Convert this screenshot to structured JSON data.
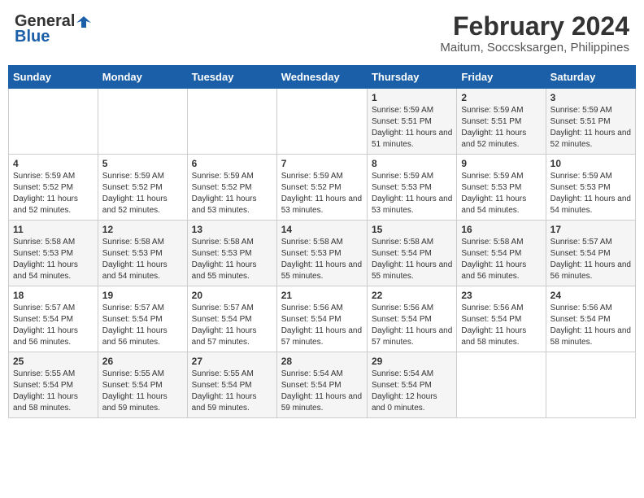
{
  "logo": {
    "line1": "General",
    "line2": "Blue"
  },
  "title": {
    "month": "February 2024",
    "location": "Maitum, Soccsksargen, Philippines"
  },
  "weekdays": [
    "Sunday",
    "Monday",
    "Tuesday",
    "Wednesday",
    "Thursday",
    "Friday",
    "Saturday"
  ],
  "weeks": [
    [
      {
        "day": "",
        "info": ""
      },
      {
        "day": "",
        "info": ""
      },
      {
        "day": "",
        "info": ""
      },
      {
        "day": "",
        "info": ""
      },
      {
        "day": "1",
        "info": "Sunrise: 5:59 AM\nSunset: 5:51 PM\nDaylight: 11 hours and 51 minutes."
      },
      {
        "day": "2",
        "info": "Sunrise: 5:59 AM\nSunset: 5:51 PM\nDaylight: 11 hours and 52 minutes."
      },
      {
        "day": "3",
        "info": "Sunrise: 5:59 AM\nSunset: 5:51 PM\nDaylight: 11 hours and 52 minutes."
      }
    ],
    [
      {
        "day": "4",
        "info": "Sunrise: 5:59 AM\nSunset: 5:52 PM\nDaylight: 11 hours and 52 minutes."
      },
      {
        "day": "5",
        "info": "Sunrise: 5:59 AM\nSunset: 5:52 PM\nDaylight: 11 hours and 52 minutes."
      },
      {
        "day": "6",
        "info": "Sunrise: 5:59 AM\nSunset: 5:52 PM\nDaylight: 11 hours and 53 minutes."
      },
      {
        "day": "7",
        "info": "Sunrise: 5:59 AM\nSunset: 5:52 PM\nDaylight: 11 hours and 53 minutes."
      },
      {
        "day": "8",
        "info": "Sunrise: 5:59 AM\nSunset: 5:53 PM\nDaylight: 11 hours and 53 minutes."
      },
      {
        "day": "9",
        "info": "Sunrise: 5:59 AM\nSunset: 5:53 PM\nDaylight: 11 hours and 54 minutes."
      },
      {
        "day": "10",
        "info": "Sunrise: 5:59 AM\nSunset: 5:53 PM\nDaylight: 11 hours and 54 minutes."
      }
    ],
    [
      {
        "day": "11",
        "info": "Sunrise: 5:58 AM\nSunset: 5:53 PM\nDaylight: 11 hours and 54 minutes."
      },
      {
        "day": "12",
        "info": "Sunrise: 5:58 AM\nSunset: 5:53 PM\nDaylight: 11 hours and 54 minutes."
      },
      {
        "day": "13",
        "info": "Sunrise: 5:58 AM\nSunset: 5:53 PM\nDaylight: 11 hours and 55 minutes."
      },
      {
        "day": "14",
        "info": "Sunrise: 5:58 AM\nSunset: 5:53 PM\nDaylight: 11 hours and 55 minutes."
      },
      {
        "day": "15",
        "info": "Sunrise: 5:58 AM\nSunset: 5:54 PM\nDaylight: 11 hours and 55 minutes."
      },
      {
        "day": "16",
        "info": "Sunrise: 5:58 AM\nSunset: 5:54 PM\nDaylight: 11 hours and 56 minutes."
      },
      {
        "day": "17",
        "info": "Sunrise: 5:57 AM\nSunset: 5:54 PM\nDaylight: 11 hours and 56 minutes."
      }
    ],
    [
      {
        "day": "18",
        "info": "Sunrise: 5:57 AM\nSunset: 5:54 PM\nDaylight: 11 hours and 56 minutes."
      },
      {
        "day": "19",
        "info": "Sunrise: 5:57 AM\nSunset: 5:54 PM\nDaylight: 11 hours and 56 minutes."
      },
      {
        "day": "20",
        "info": "Sunrise: 5:57 AM\nSunset: 5:54 PM\nDaylight: 11 hours and 57 minutes."
      },
      {
        "day": "21",
        "info": "Sunrise: 5:56 AM\nSunset: 5:54 PM\nDaylight: 11 hours and 57 minutes."
      },
      {
        "day": "22",
        "info": "Sunrise: 5:56 AM\nSunset: 5:54 PM\nDaylight: 11 hours and 57 minutes."
      },
      {
        "day": "23",
        "info": "Sunrise: 5:56 AM\nSunset: 5:54 PM\nDaylight: 11 hours and 58 minutes."
      },
      {
        "day": "24",
        "info": "Sunrise: 5:56 AM\nSunset: 5:54 PM\nDaylight: 11 hours and 58 minutes."
      }
    ],
    [
      {
        "day": "25",
        "info": "Sunrise: 5:55 AM\nSunset: 5:54 PM\nDaylight: 11 hours and 58 minutes."
      },
      {
        "day": "26",
        "info": "Sunrise: 5:55 AM\nSunset: 5:54 PM\nDaylight: 11 hours and 59 minutes."
      },
      {
        "day": "27",
        "info": "Sunrise: 5:55 AM\nSunset: 5:54 PM\nDaylight: 11 hours and 59 minutes."
      },
      {
        "day": "28",
        "info": "Sunrise: 5:54 AM\nSunset: 5:54 PM\nDaylight: 11 hours and 59 minutes."
      },
      {
        "day": "29",
        "info": "Sunrise: 5:54 AM\nSunset: 5:54 PM\nDaylight: 12 hours and 0 minutes."
      },
      {
        "day": "",
        "info": ""
      },
      {
        "day": "",
        "info": ""
      }
    ]
  ]
}
